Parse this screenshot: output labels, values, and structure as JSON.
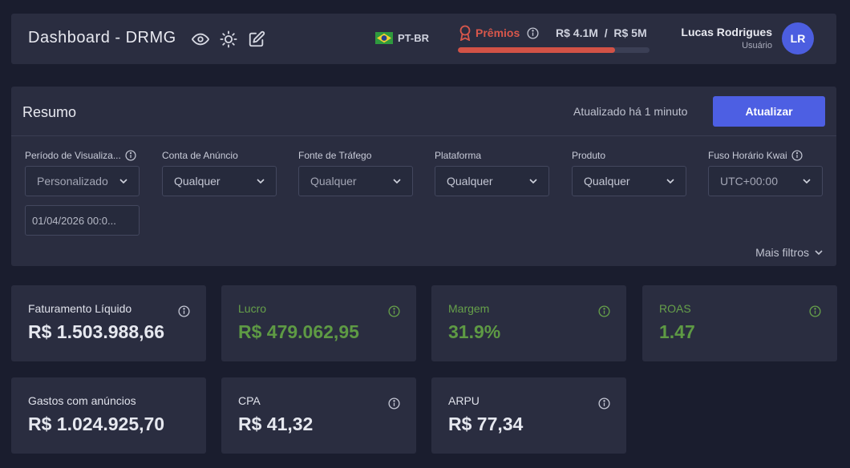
{
  "header": {
    "title": "Dashboard - DRMG",
    "language": "PT-BR",
    "prize": {
      "label": "Prêmios",
      "current": "R$ 4.1M",
      "separator": "/",
      "target": "R$ 5M",
      "progress_percent": 82
    },
    "user": {
      "name": "Lucas Rodrigues",
      "role": "Usuário",
      "initials": "LR"
    },
    "icons": [
      "eye-icon",
      "sun-icon",
      "edit-icon"
    ]
  },
  "summary": {
    "title": "Resumo",
    "updated_text": "Atualizado há 1 minuto",
    "refresh_label": "Atualizar",
    "filters": [
      {
        "label": "Período de Visualiza...",
        "value": "Personalizado",
        "has_info": true
      },
      {
        "label": "Conta de Anúncio",
        "value": "Qualquer",
        "has_info": false
      },
      {
        "label": "Fonte de Tráfego",
        "value": "Qualquer",
        "has_info": false
      },
      {
        "label": "Plataforma",
        "value": "Qualquer",
        "has_info": false
      },
      {
        "label": "Produto",
        "value": "Qualquer",
        "has_info": false
      },
      {
        "label": "Fuso Horário Kwai",
        "value": "UTC+00:00",
        "has_info": true
      }
    ],
    "date_value": "01/04/2026 00:0...",
    "more_filters_label": "Mais filtros"
  },
  "metrics": [
    {
      "label": "Faturamento Líquido",
      "value": "R$ 1.503.988,66",
      "accent": false
    },
    {
      "label": "Lucro",
      "value": "R$ 479.062,95",
      "accent": true
    },
    {
      "label": "Margem",
      "value": "31.9%",
      "accent": true
    },
    {
      "label": "ROAS",
      "value": "1.47",
      "accent": true
    },
    {
      "label": "Gastos com anúncios",
      "value": "R$ 1.024.925,70",
      "accent": false
    },
    {
      "label": "CPA",
      "value": "R$ 41,32",
      "accent": false
    },
    {
      "label": "ARPU",
      "value": "R$ 77,34",
      "accent": false
    }
  ],
  "colors": {
    "background": "#1a1d2e",
    "panel": "#2a2d40",
    "accent_blue": "#4d5fe3",
    "prize_red": "#d9574b",
    "positive_green": "#5e9a44"
  }
}
